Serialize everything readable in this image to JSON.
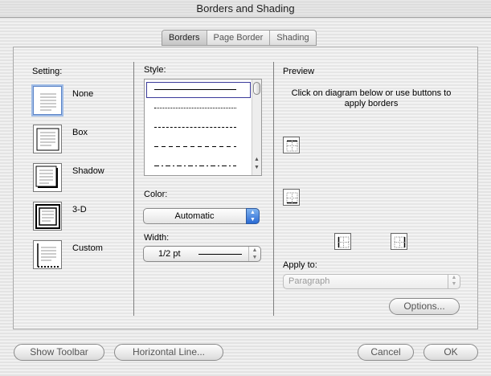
{
  "window": {
    "title": "Borders and Shading"
  },
  "tabs": [
    {
      "label": "Borders",
      "active": true
    },
    {
      "label": "Page Border",
      "active": false
    },
    {
      "label": "Shading",
      "active": false
    }
  ],
  "setting": {
    "label": "Setting:",
    "options": [
      {
        "label": "None",
        "icon": "none-setting-icon",
        "selected": true
      },
      {
        "label": "Box",
        "icon": "box-setting-icon",
        "selected": false
      },
      {
        "label": "Shadow",
        "icon": "shadow-setting-icon",
        "selected": false
      },
      {
        "label": "3-D",
        "icon": "3d-setting-icon",
        "selected": false
      },
      {
        "label": "Custom",
        "icon": "custom-setting-icon",
        "selected": false
      }
    ]
  },
  "style": {
    "label": "Style:",
    "options": [
      "solid",
      "dotted",
      "dashed",
      "long-dashed",
      "dash-dot"
    ],
    "selected": "solid"
  },
  "color": {
    "label": "Color:",
    "value": "Automatic"
  },
  "width": {
    "label": "Width:",
    "value": "1/2 pt"
  },
  "preview": {
    "label": "Preview",
    "instructions": "Click on diagram below or use buttons to apply borders",
    "buttons": [
      "top-border-icon",
      "bottom-border-icon",
      "left-border-icon",
      "right-border-icon"
    ]
  },
  "apply_to": {
    "label": "Apply to:",
    "value": "Paragraph"
  },
  "buttons": {
    "options": "Options...",
    "show_toolbar": "Show Toolbar",
    "horizontal_line": "Horizontal Line...",
    "cancel": "Cancel",
    "ok": "OK"
  },
  "colors": {
    "accent_blue": "#2a6ad3",
    "selection": "#9fbbe5"
  }
}
